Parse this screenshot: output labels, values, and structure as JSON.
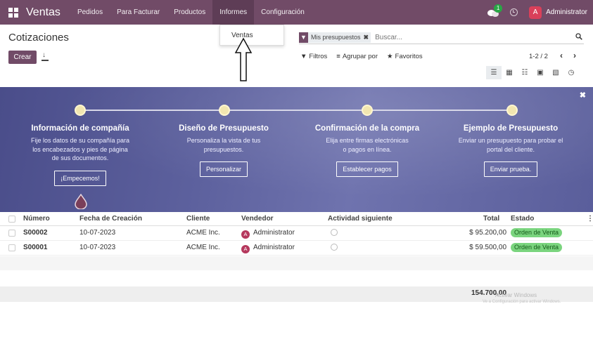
{
  "navbar": {
    "brand": "Ventas",
    "menu": [
      "Pedidos",
      "Para Facturar",
      "Productos",
      "Informes",
      "Configuración"
    ],
    "active_menu": "Informes",
    "message_badge": "1",
    "user_initial": "A",
    "user_name": "Administrator",
    "color": "#714b67"
  },
  "dropdown": {
    "item": "Ventas"
  },
  "control": {
    "title": "Cotizaciones",
    "create_label": "Crear",
    "facet_label": "Mis presupuestos",
    "search_placeholder": "Buscar...",
    "filters_label": "Filtros",
    "groupby_label": "Agrupar por",
    "favorites_label": "Favoritos",
    "pager": "1-2 / 2"
  },
  "banner": {
    "steps": [
      {
        "title": "Información de compañía",
        "desc": "Fije los datos de su compañía para los encabezados y pies de página de sus documentos.",
        "button": "¡Empecemos!"
      },
      {
        "title": "Diseño de Presupuesto",
        "desc": "Personaliza la vista de tus presupuestos.",
        "button": "Personalizar"
      },
      {
        "title": "Confirmación de la compra",
        "desc": "Elija entre firmas electrónicas o pagos en línea.",
        "button": "Establecer pagos"
      },
      {
        "title": "Ejemplo de Presupuesto",
        "desc": "Enviar un presupuesto para probar el portal del cliente.",
        "button": "Enviar prueba."
      }
    ]
  },
  "table": {
    "headers": {
      "number": "Número",
      "date": "Fecha de Creación",
      "client": "Cliente",
      "seller": "Vendedor",
      "activity": "Actividad siguiente",
      "total": "Total",
      "state": "Estado"
    },
    "rows": [
      {
        "number": "S00002",
        "date": "10-07-2023",
        "client": "ACME Inc.",
        "seller": "Administrator",
        "seller_initial": "A",
        "total": "$ 95.200,00",
        "state": "Orden de Venta"
      },
      {
        "number": "S00001",
        "date": "10-07-2023",
        "client": "ACME Inc.",
        "seller": "Administrator",
        "seller_initial": "A",
        "total": "$ 59.500,00",
        "state": "Orden de Venta"
      }
    ],
    "sum_total": "154.700,00"
  },
  "watermark": {
    "line1": "Activar Windows",
    "line2": "Ve a Configuración para activar Windows."
  }
}
